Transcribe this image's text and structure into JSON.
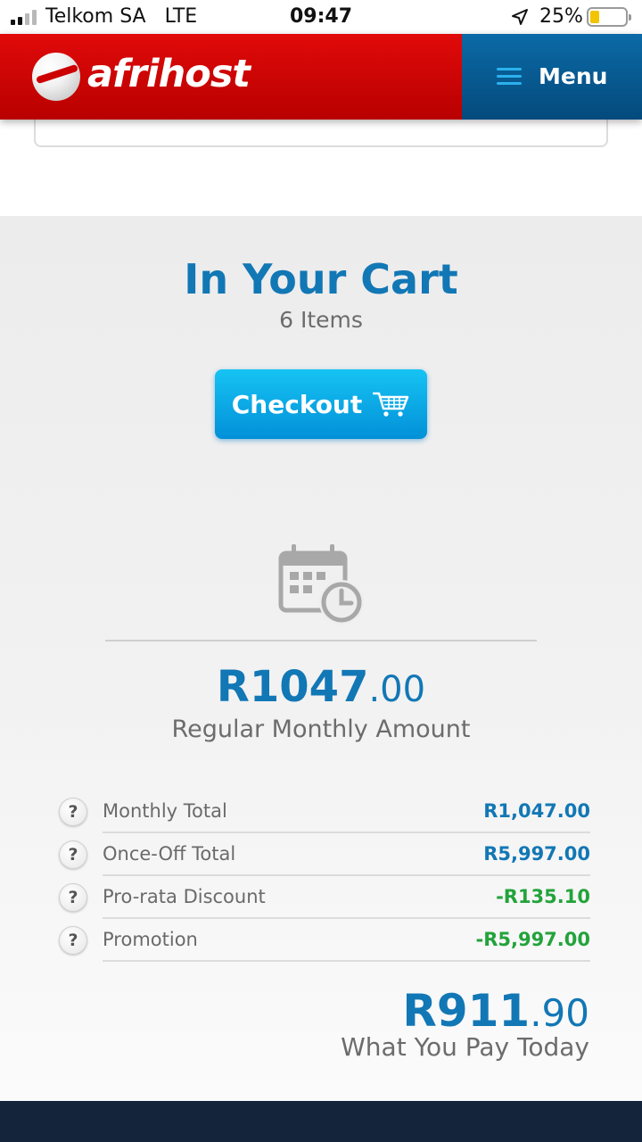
{
  "status_bar": {
    "carrier": "Telkom SA",
    "network": "LTE",
    "time": "09:47",
    "battery_percent": "25%",
    "signal_bars": 2,
    "battery_level": 0.25,
    "icons": [
      "signal-icon",
      "location-arrow-icon",
      "battery-icon"
    ]
  },
  "header": {
    "brand": "afrihost",
    "menu_label": "Menu",
    "brand_color": "#d00000",
    "menu_color": "#0a5f99"
  },
  "cart": {
    "title": "In Your Cart",
    "items_count": "6 Items",
    "checkout_label": "Checkout"
  },
  "monthly": {
    "amount_main": "R1047",
    "amount_cents": ".00",
    "label": "Regular Monthly Amount"
  },
  "summary": [
    {
      "label": "Monthly Total",
      "value": "R1,047.00",
      "color": "#1277b5"
    },
    {
      "label": "Once-Off Total",
      "value": "R5,997.00",
      "color": "#1277b5"
    },
    {
      "label": "Pro-rata Discount",
      "value": "-R135.10",
      "color": "#23a33b"
    },
    {
      "label": "Promotion",
      "value": "-R5,997.00",
      "color": "#23a33b"
    }
  ],
  "pay_today": {
    "amount_main": "R911",
    "amount_cents": ".90",
    "label": "What You Pay Today"
  },
  "help_symbol": "?"
}
